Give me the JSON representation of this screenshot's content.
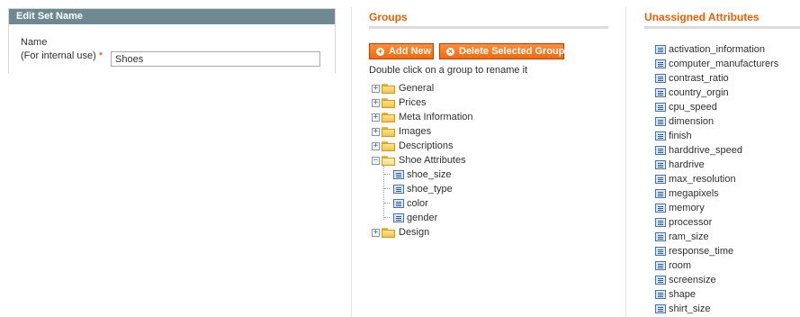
{
  "set_name_panel": {
    "header": "Edit Set Name",
    "label": "Name",
    "sublabel": "(For internal use)",
    "required_mark": "*",
    "value": "Shoes"
  },
  "groups": {
    "title": "Groups",
    "add_button": "Add New",
    "delete_button": "Delete Selected Group",
    "hint": "Double click on a group to rename it",
    "tree": [
      {
        "label": "General",
        "expanded": false
      },
      {
        "label": "Prices",
        "expanded": false
      },
      {
        "label": "Meta Information",
        "expanded": false
      },
      {
        "label": "Images",
        "expanded": false
      },
      {
        "label": "Descriptions",
        "expanded": false
      },
      {
        "label": "Shoe Attributes",
        "expanded": true,
        "children": [
          "shoe_size",
          "shoe_type",
          "color",
          "gender"
        ]
      },
      {
        "label": "Design",
        "expanded": false
      }
    ]
  },
  "unassigned": {
    "title": "Unassigned Attributes",
    "items": [
      "activation_information",
      "computer_manufacturers",
      "contrast_ratio",
      "country_orgin",
      "cpu_speed",
      "dimension",
      "finish",
      "harddrive_speed",
      "hardrive",
      "max_resolution",
      "megapixels",
      "memory",
      "processor",
      "ram_size",
      "response_time",
      "room",
      "screensize",
      "shape",
      "shirt_size"
    ]
  },
  "colors": {
    "accent": "#eb5e00",
    "button": "#f06a10",
    "panel_header": "#6f8992",
    "required": "#eb340a"
  },
  "icons": {
    "add": "plus-circle-icon",
    "delete": "cancel-circle-icon",
    "group": "folder-icon",
    "attribute": "attribute-icon"
  }
}
